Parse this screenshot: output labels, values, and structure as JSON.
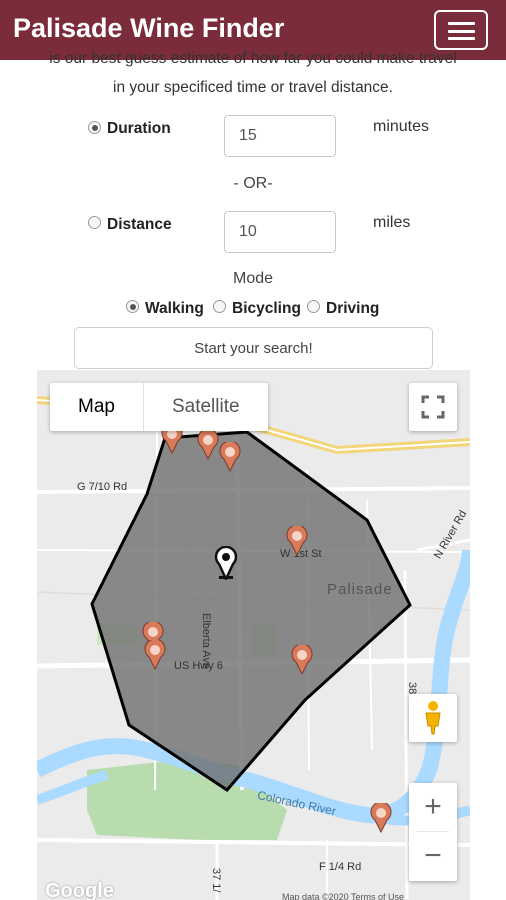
{
  "header": {
    "title": "Palisade Wine Finder",
    "menu_icon": "hamburger-menu-icon",
    "bg_color": "#7a2c3a"
  },
  "intro": {
    "line1": "is our best guess estimate of how far you could make travel",
    "line2": "in your specificed time or travel distance."
  },
  "duration": {
    "label": "Duration",
    "value": "15",
    "unit": "minutes",
    "selected": true
  },
  "or_text": "- OR-",
  "distance": {
    "label": "Distance",
    "value": "10",
    "unit": "miles",
    "selected": false
  },
  "mode": {
    "label": "Mode",
    "options": [
      {
        "label": "Walking",
        "selected": true
      },
      {
        "label": "Bicycling",
        "selected": false
      },
      {
        "label": "Driving",
        "selected": false
      }
    ]
  },
  "search_button": "Start your search!",
  "map": {
    "type_map": "Map",
    "type_satellite": "Satellite",
    "labels": {
      "g_road": "G 7/10 Rd",
      "w_1st": "W 1st St",
      "palisade": "Palisade",
      "elberta": "Elberta Ave",
      "us_hwy": "US Hwy 6",
      "n_river": "N River Rd",
      "colorado": "Colorado River",
      "f_road": "F 1/4 Rd",
      "road_38": "38",
      "road_37": "37 1/",
      "google": "Google",
      "attribution": "Map data ©2020   Terms of Use"
    },
    "zoom_in": "+",
    "zoom_out": "−",
    "isochrone_fill": "#6b6b6b",
    "marker_color": "#d97a5a"
  }
}
